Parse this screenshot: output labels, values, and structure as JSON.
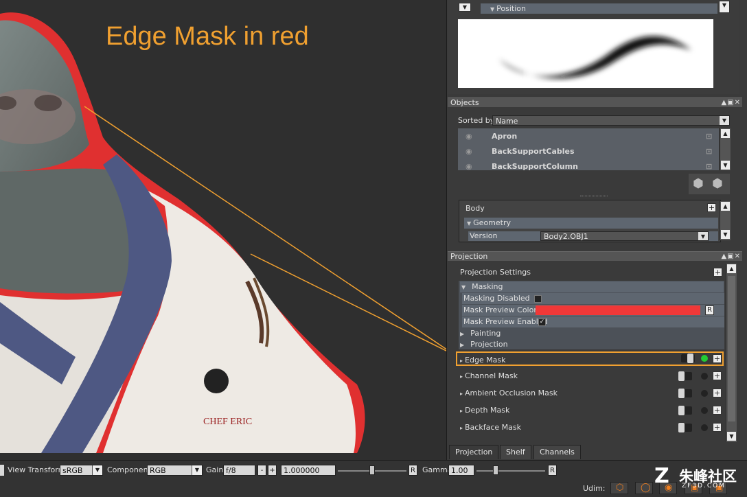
{
  "annotation": {
    "text": "Edge Mask in red"
  },
  "top_panel": {
    "position_label": "Position"
  },
  "objects_panel": {
    "title": "Objects",
    "sorted_by_label": "Sorted by",
    "sorted_by_value": "Name",
    "items": [
      "Apron",
      "BackSupportCables",
      "BackSupportColumn"
    ]
  },
  "body_panel": {
    "title": "Body",
    "geometry_label": "Geometry",
    "version_label": "Version",
    "version_value": "Body2.OBJ1"
  },
  "projection_panel": {
    "title": "Projection",
    "settings_label": "Projection Settings",
    "masking_label": "Masking",
    "masking_disabled_label": "Masking Disabled",
    "mask_preview_color_label": "Mask Preview Color",
    "mask_preview_color": "#f03838",
    "r_label": "R",
    "mask_preview_enabled_label": "Mask Preview Enabled",
    "painting_label": "Painting",
    "projection_label": "Projection",
    "masks": [
      "Edge Mask",
      "Channel Mask",
      "Ambient Occlusion Mask",
      "Depth Mask",
      "Backface Mask"
    ],
    "highlight_color": "#f0a030",
    "active_dot_color": "#22cc33"
  },
  "tabs": [
    "Projection",
    "Shelf",
    "Channels"
  ],
  "bottombar": {
    "view_transform_label": "View Transform",
    "view_transform_value": "sRGB",
    "component_label": "Component",
    "component_value": "RGB",
    "gain_label": "Gain",
    "gain_value": "f/8",
    "minus": "-",
    "plus": "+",
    "gain_number": "1.000000",
    "r_label": "R",
    "gamma_label": "Gamma",
    "gamma_value": "1.00",
    "udim_label": "Udim:"
  },
  "watermark": {
    "text": "朱峰社区",
    "sub": "ZF3D.COM"
  }
}
